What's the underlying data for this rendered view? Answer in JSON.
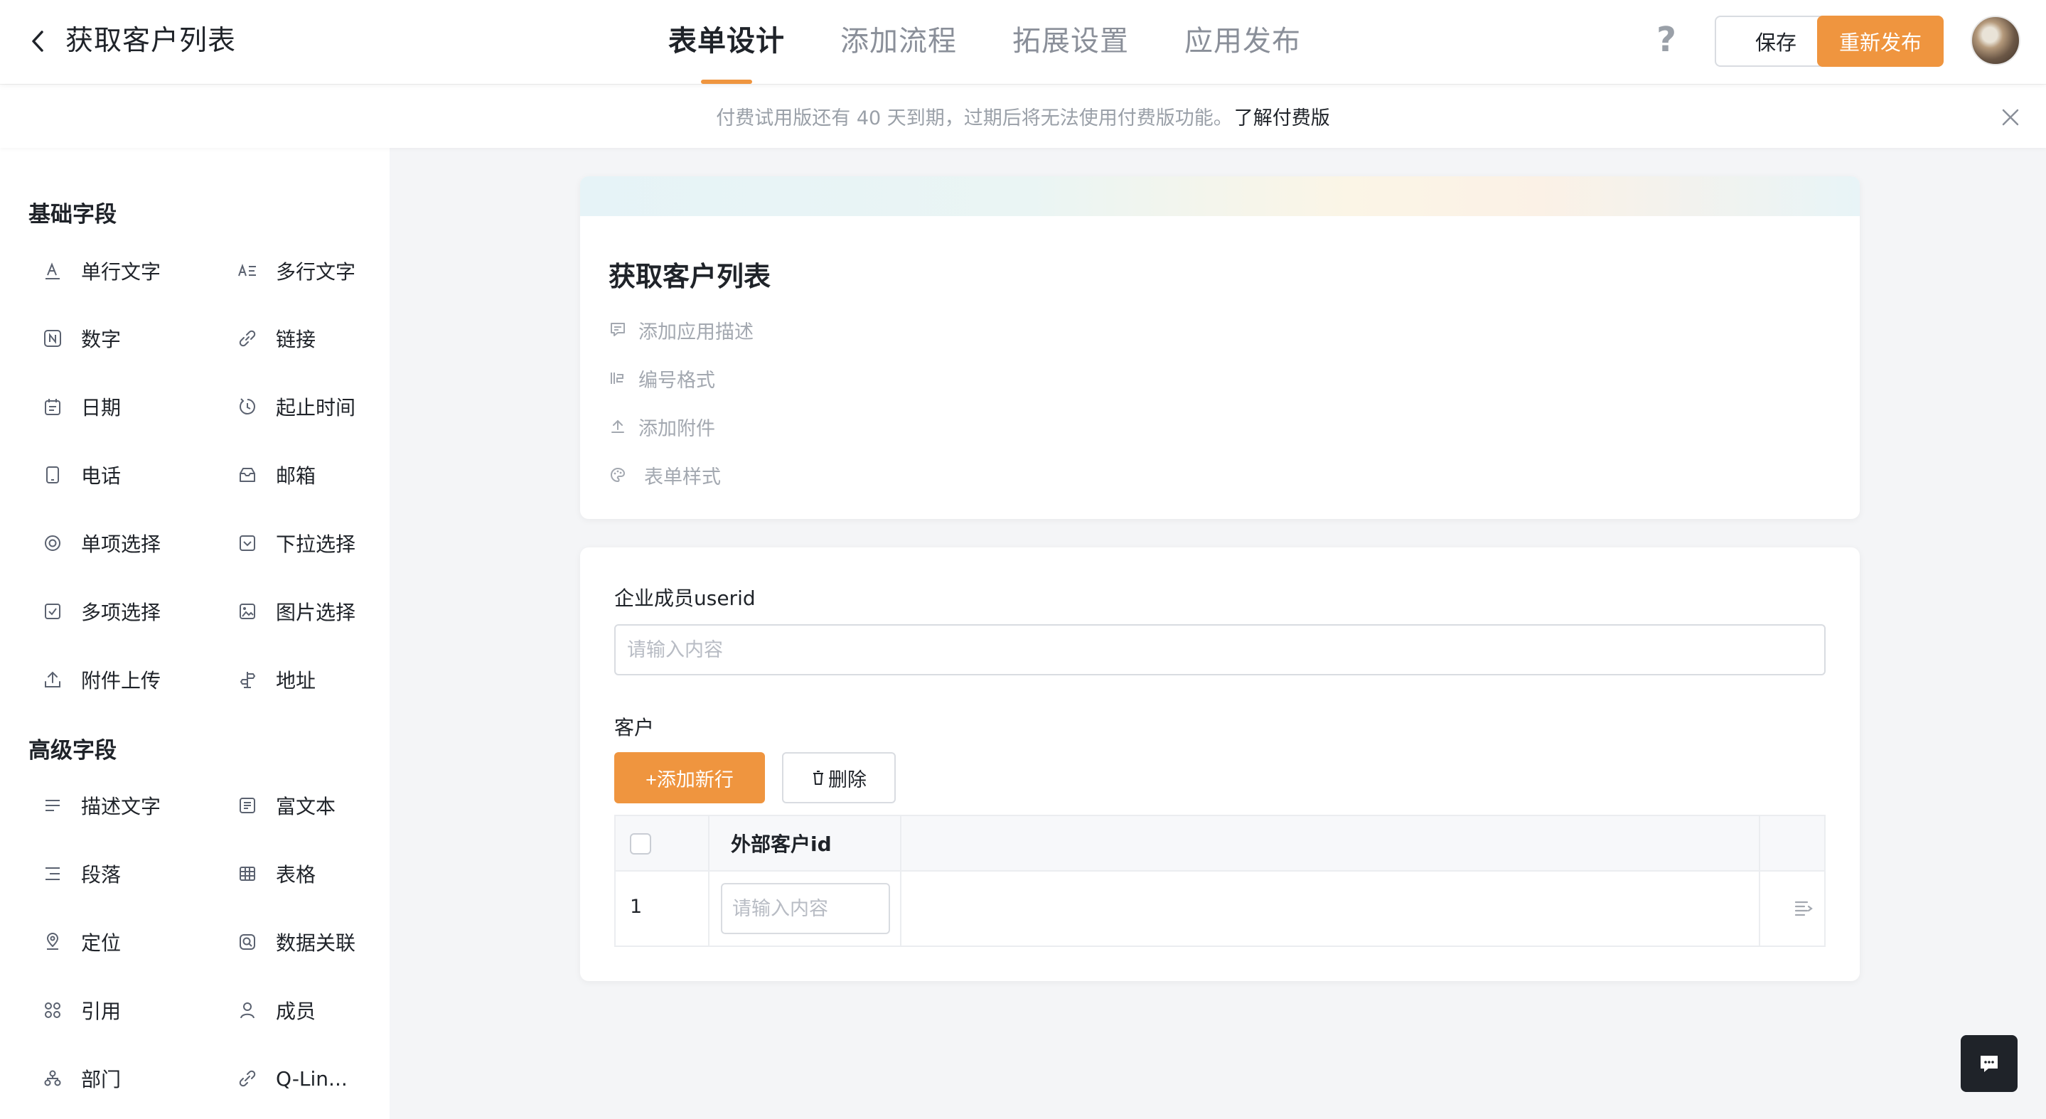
{
  "header": {
    "title": "获取客户列表",
    "tabs": [
      {
        "label": "表单设计",
        "active": true
      },
      {
        "label": "添加流程",
        "active": false
      },
      {
        "label": "拓展设置",
        "active": false
      },
      {
        "label": "应用发布",
        "active": false
      }
    ],
    "help_glyph": "?",
    "save_label": "保存",
    "publish_label": "重新发布"
  },
  "notice": {
    "text": "付费试用版还有 40 天到期，过期后将无法使用付费版功能。",
    "link": "了解付费版"
  },
  "sidebar": {
    "basic_title": "基础字段",
    "basic_fields": [
      {
        "label": "单行文字",
        "icon": "single-line-text-icon"
      },
      {
        "label": "多行文字",
        "icon": "multi-line-text-icon"
      },
      {
        "label": "数字",
        "icon": "number-icon"
      },
      {
        "label": "链接",
        "icon": "link-icon"
      },
      {
        "label": "日期",
        "icon": "date-icon"
      },
      {
        "label": "起止时间",
        "icon": "time-range-icon"
      },
      {
        "label": "电话",
        "icon": "phone-icon"
      },
      {
        "label": "邮箱",
        "icon": "mail-icon"
      },
      {
        "label": "单项选择",
        "icon": "radio-icon"
      },
      {
        "label": "下拉选择",
        "icon": "dropdown-icon"
      },
      {
        "label": "多项选择",
        "icon": "checkbox-icon"
      },
      {
        "label": "图片选择",
        "icon": "image-icon"
      },
      {
        "label": "附件上传",
        "icon": "upload-icon"
      },
      {
        "label": "地址",
        "icon": "address-icon"
      }
    ],
    "advanced_title": "高级字段",
    "advanced_fields": [
      {
        "label": "描述文字",
        "icon": "description-icon"
      },
      {
        "label": "富文本",
        "icon": "rich-text-icon"
      },
      {
        "label": "段落",
        "icon": "paragraph-icon"
      },
      {
        "label": "表格",
        "icon": "table-icon"
      },
      {
        "label": "定位",
        "icon": "location-icon"
      },
      {
        "label": "数据关联",
        "icon": "data-link-icon"
      },
      {
        "label": "引用",
        "icon": "reference-icon"
      },
      {
        "label": "成员",
        "icon": "member-icon"
      },
      {
        "label": "部门",
        "icon": "department-icon"
      },
      {
        "label": "Q-Lin...",
        "icon": "q-link-icon"
      }
    ]
  },
  "form": {
    "title": "获取客户列表",
    "options": [
      {
        "label": "添加应用描述",
        "icon": "comment-icon"
      },
      {
        "label": "编号格式",
        "icon": "numbering-icon"
      },
      {
        "label": "添加附件",
        "icon": "attach-icon"
      },
      {
        "label": "表单样式",
        "icon": "palette-icon"
      }
    ],
    "userid_label": "企业成员userid",
    "input_placeholder": "请输入内容",
    "customer_label": "客户",
    "add_row_label": "+添加新行",
    "delete_label": "删除",
    "table": {
      "column_header": "外部客户id",
      "rows": [
        {
          "index": "1"
        }
      ]
    }
  },
  "colors": {
    "accent": "#ef953f",
    "text_primary": "#1f2329",
    "text_muted": "#8a8f99",
    "background": "#f4f5f7"
  }
}
